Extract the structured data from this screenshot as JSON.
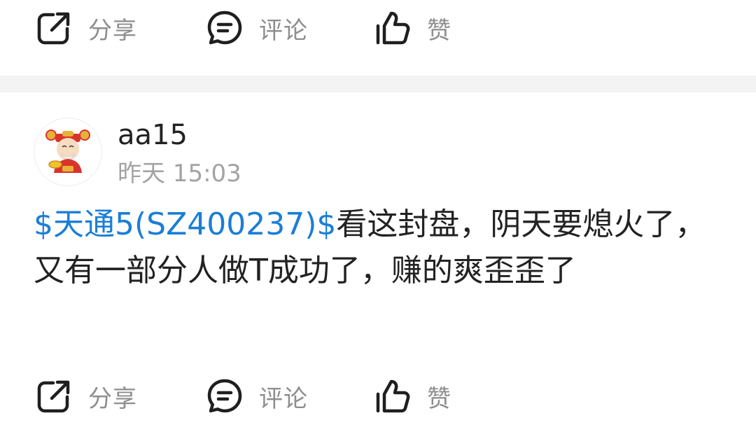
{
  "top_actions": {
    "share_label": "分享",
    "comment_label": "评论",
    "like_label": "赞"
  },
  "post": {
    "username": "aa15",
    "timestamp": "昨天 15:03",
    "stock_tag": "$天通5(SZ400237)$",
    "content": "看这封盘，阴天要熄火了，又有一部分人做T成功了，赚的爽歪歪了"
  },
  "bottom_actions": {
    "share_label": "分享",
    "comment_label": "评论",
    "like_label": "赞"
  },
  "colors": {
    "link": "#1a7ed6",
    "icon": "#1f1f1f",
    "label": "#8e8e8e",
    "divider": "#f3f3f3"
  }
}
